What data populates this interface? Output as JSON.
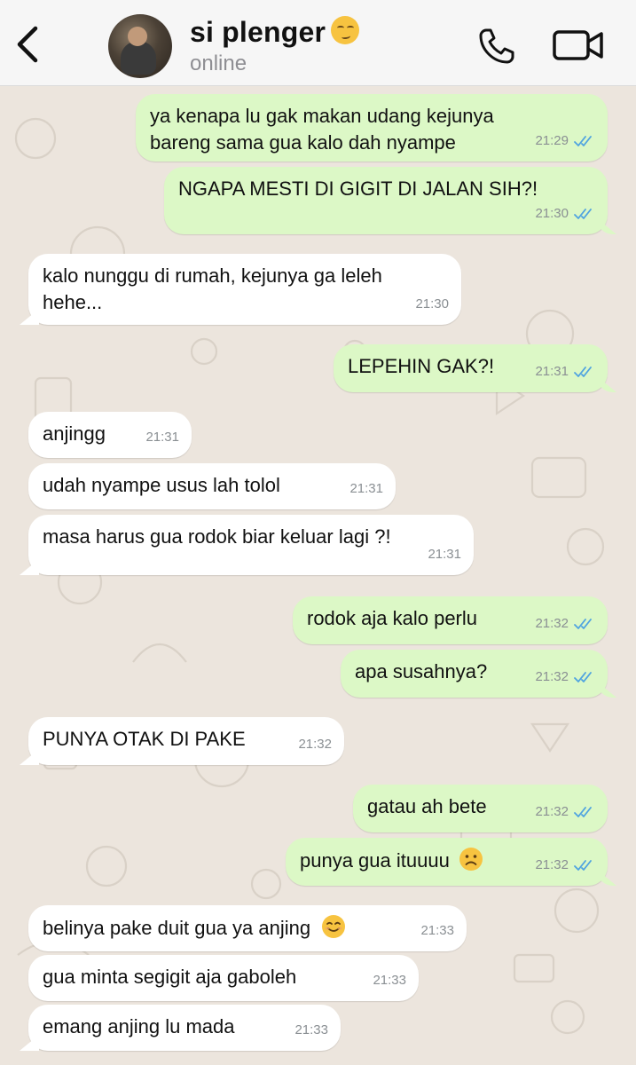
{
  "header": {
    "back_icon": "chevron-left-icon",
    "contact_name": "si plenger",
    "contact_emoji": "relieved-face-emoji",
    "status": "online",
    "call_icon": "phone-icon",
    "video_icon": "video-camera-icon"
  },
  "messages": [
    {
      "dir": "out",
      "text": "ya kenapa lu gak makan udang kejunya\nbareng sama gua kalo dah nyampe",
      "time": "21:29",
      "read": true
    },
    {
      "dir": "out",
      "text": "NGAPA MESTI DI GIGIT DI JALAN SIH?!",
      "time": "21:30",
      "read": true
    },
    {
      "dir": "in",
      "text": "kalo nunggu di rumah, kejunya ga leleh\nhehe...",
      "time": "21:30"
    },
    {
      "dir": "out",
      "text": "LEPEHIN GAK?!",
      "time": "21:31",
      "read": true
    },
    {
      "dir": "in",
      "text": "anjingg",
      "time": "21:31"
    },
    {
      "dir": "in",
      "text": "udah nyampe usus lah tolol",
      "time": "21:31"
    },
    {
      "dir": "in",
      "text": "masa harus gua rodok biar keluar lagi ?!",
      "time": "21:31"
    },
    {
      "dir": "out",
      "text": "rodok aja kalo perlu",
      "time": "21:32",
      "read": true
    },
    {
      "dir": "out",
      "text": "apa susahnya?",
      "time": "21:32",
      "read": true
    },
    {
      "dir": "in",
      "text": "PUNYA OTAK DI PAKE",
      "time": "21:32"
    },
    {
      "dir": "out",
      "text": "gatau ah bete",
      "time": "21:32",
      "read": true
    },
    {
      "dir": "out",
      "text": "punya gua ituuuu",
      "emoji": "frowning-face-emoji",
      "time": "21:32",
      "read": true
    },
    {
      "dir": "in",
      "text": "belinya pake duit gua ya anjing",
      "emoji": "smiling-face-emoji",
      "time": "21:33"
    },
    {
      "dir": "in",
      "text": "gua minta segigit aja gaboleh",
      "time": "21:33"
    },
    {
      "dir": "in",
      "text": "emang anjing lu mada",
      "time": "21:33"
    }
  ],
  "colors": {
    "outgoing_bubble": "#dcf8c6",
    "incoming_bubble": "#ffffff",
    "chat_background": "#ece5dd",
    "read_ticks": "#4fa3e0"
  }
}
